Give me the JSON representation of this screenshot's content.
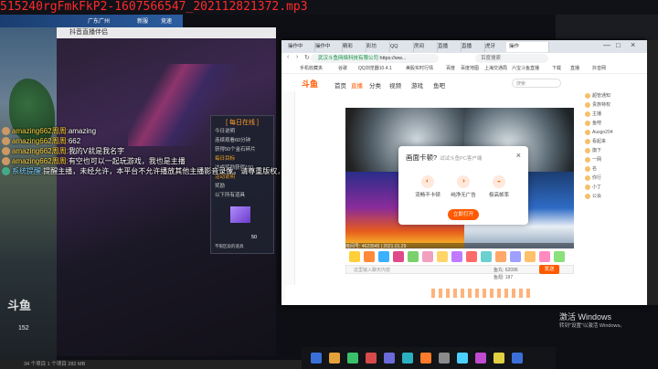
{
  "window_title": "515240rgFmkFkP2-1607566547_202112821372.mp3",
  "game_topbar": {
    "location": "广东广州",
    "items": [
      "新服",
      "竞速",
      "猪仔"
    ]
  },
  "game_window": {
    "title": "抖音直播伴侣"
  },
  "chat": [
    {
      "user": "amazing662周周:",
      "text": "amazing"
    },
    {
      "user": "amazing662周周:",
      "text": "662"
    },
    {
      "user": "amazing662周周:",
      "text": "我的V就是我名字"
    },
    {
      "user": "amazing662周周:",
      "text": "有空也可以一起玩游戏，我也是主播"
    },
    {
      "user": "系统提醒:",
      "text": "提醒主播，未经允许，本平台不允许播放其他主播影音录像。请尊重版权，谢谢配合。"
    }
  ],
  "daily_task": {
    "header": "[ 每日在线 ]",
    "lines": [
      "今日说明",
      "连续观看60分钟",
      "获得50个金石碎片",
      "每日目标",
      "达成奖励获得100",
      "活动说明",
      "奖励",
      "以下所有道具"
    ],
    "cube_label": "50",
    "cube_note": "不限区段的道具"
  },
  "browser": {
    "tabs": [
      "操作中",
      "操作中",
      "精彩",
      "彩坊",
      "QQ",
      "房间",
      "直播",
      "直播",
      "虎牙",
      "操作"
    ],
    "url": "https://ww...",
    "url_label": "武汉斗鱼网络科技有限公司",
    "search_placeholder": "百度搜索",
    "bookmarks": [
      "手机收藏夹",
      "谷歌",
      "QQ浏览器10.4.1",
      "美股实时行情",
      "百度",
      "百度地图",
      "上海交通局",
      "六宝斗鱼直播",
      "下载",
      "直播",
      "抖音网"
    ]
  },
  "site": {
    "logo": "斗鱼",
    "nav": [
      "首页",
      "直播",
      "分类",
      "视频",
      "游戏",
      "鱼吧"
    ],
    "search_placeholder": "搜索",
    "room_id_label": "房间号: 4623545 | 2021.01.29",
    "chat_placeholder": "这里输入聊天内容",
    "send": "发送",
    "gifts_count": "鱼丸: 62096",
    "fans": "鱼翅: 187"
  },
  "modal": {
    "title": "画面卡顿?",
    "subtitle": "试试斗鱼PC客户端",
    "close": "×",
    "options": [
      {
        "icon": "◐",
        "label": "流畅不卡顿"
      },
      {
        "icon": "◑",
        "label": "纯净无广告"
      },
      {
        "icon": "◒",
        "label": "极高帧率"
      }
    ],
    "button": "立即打开"
  },
  "right_list": [
    "超管通知",
    "贵族特权",
    "主播",
    "鱼吧",
    "Ausgo204",
    "看起来",
    "旗下",
    "一网",
    "名",
    "你行",
    "小丁",
    "公会"
  ],
  "activate": {
    "line1": "激活 Windows",
    "line2": "转到\"设置\"以激活 Windows。"
  },
  "status_bar": "34 个项目  1 个项目  282 MB",
  "watermark": "斗鱼",
  "counter": "152"
}
